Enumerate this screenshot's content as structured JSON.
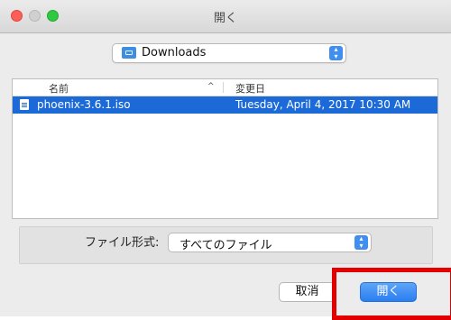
{
  "window": {
    "title": "開く"
  },
  "location": {
    "label": "Downloads",
    "icon": "folder-icon"
  },
  "browser": {
    "columns": {
      "name": "名前",
      "date": "変更日",
      "sort_indicator": "^"
    },
    "rows": [
      {
        "name": "phoenix-3.6.1.iso",
        "date": "Tuesday, April 4, 2017 10:30 AM",
        "selected": true
      }
    ]
  },
  "format": {
    "label": "ファイル形式:",
    "value": "すべてのファイル"
  },
  "buttons": {
    "cancel": "取消",
    "open": "開く"
  },
  "colors": {
    "accent": "#1c6ad8",
    "highlight": "#e30000"
  }
}
